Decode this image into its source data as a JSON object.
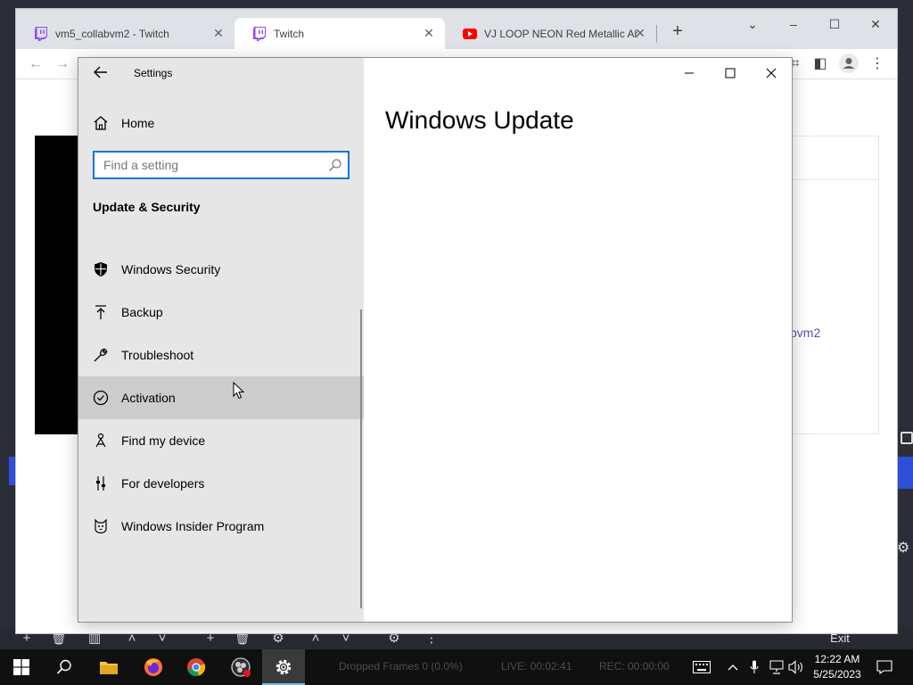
{
  "chrome": {
    "tabs": [
      {
        "title": "vm5_collabvm2 - Twitch",
        "favicon": "twitch-icon",
        "active": false
      },
      {
        "title": "Twitch",
        "favicon": "twitch-icon",
        "active": true
      },
      {
        "title": "VJ LOOP NEON Red Metallic Ab",
        "favicon": "youtube-icon",
        "active": false
      }
    ],
    "page_link_text": "bvm2"
  },
  "settings": {
    "window_title": "Settings",
    "home_label": "Home",
    "search_placeholder": "Find a setting",
    "section_title": "Update & Security",
    "content_title": "Windows Update",
    "nav_items": [
      {
        "label": "Windows Security",
        "icon": "shield-icon"
      },
      {
        "label": "Backup",
        "icon": "backup-arrow-icon"
      },
      {
        "label": "Troubleshoot",
        "icon": "wrench-icon"
      },
      {
        "label": "Activation",
        "icon": "check-circle-icon",
        "hovered": true
      },
      {
        "label": "Find my device",
        "icon": "person-locate-icon"
      },
      {
        "label": "For developers",
        "icon": "developer-tools-icon"
      },
      {
        "label": "Windows Insider Program",
        "icon": "insider-cat-icon"
      }
    ]
  },
  "obs": {
    "exit_label": "Exit",
    "dropped_frames": "Dropped Frames 0 (0.0%)",
    "live_time": "LIVE: 00:02:41",
    "rec_time": "REC: 00:00:00"
  },
  "taskbar": {
    "time": "12:22 AM",
    "date": "5/25/2023"
  },
  "colors": {
    "accent": "#0078d7",
    "nav_background": "#e6e6e6",
    "nav_hover": "#cccccc",
    "taskbar": "#101010",
    "twitch": "#9146ff",
    "youtube": "#ff0000"
  }
}
